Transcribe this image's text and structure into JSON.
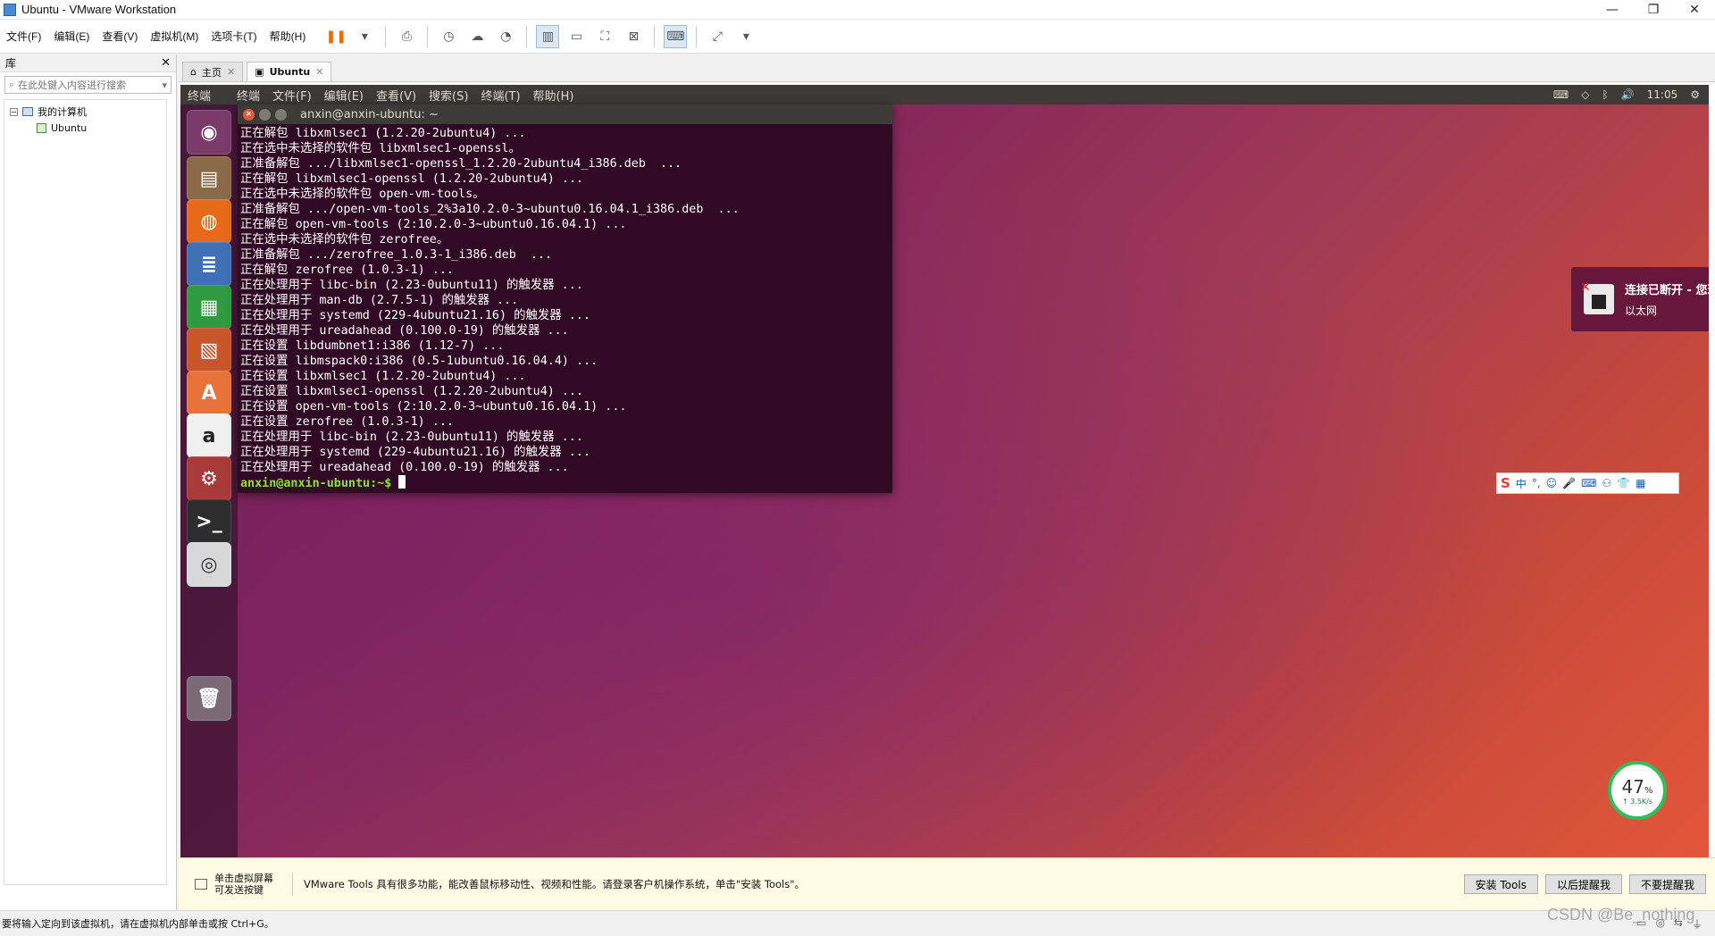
{
  "window": {
    "title": "Ubuntu - VMware Workstation",
    "minimize": "—",
    "restore": "❐",
    "close": "✕"
  },
  "menu": [
    "文件(F)",
    "编辑(E)",
    "查看(V)",
    "虚拟机(M)",
    "选项卡(T)",
    "帮助(H)"
  ],
  "library": {
    "title": "库",
    "search_placeholder": "在此处键入内容进行搜索",
    "root": "我的计算机",
    "vm": "Ubuntu"
  },
  "tabs": [
    {
      "label": "主页"
    },
    {
      "label": "Ubuntu"
    }
  ],
  "ubuntu": {
    "app_name": "终端",
    "menus": [
      "终端",
      "文件(F)",
      "编辑(E)",
      "查看(V)",
      "搜索(S)",
      "终端(T)",
      "帮助(H)"
    ],
    "clock": "11:05"
  },
  "terminal": {
    "title": "anxin@anxin-ubuntu: ~",
    "lines": [
      "正在解包 libxmlsec1 (1.2.20-2ubuntu4) ...",
      "正在选中未选择的软件包 libxmlsec1-openssl。",
      "正准备解包 .../libxmlsec1-openssl_1.2.20-2ubuntu4_i386.deb  ...",
      "正在解包 libxmlsec1-openssl (1.2.20-2ubuntu4) ...",
      "正在选中未选择的软件包 open-vm-tools。",
      "正准备解包 .../open-vm-tools_2%3a10.2.0-3~ubuntu0.16.04.1_i386.deb  ...",
      "正在解包 open-vm-tools (2:10.2.0-3~ubuntu0.16.04.1) ...",
      "正在选中未选择的软件包 zerofree。",
      "正准备解包 .../zerofree_1.0.3-1_i386.deb  ...",
      "正在解包 zerofree (1.0.3-1) ...",
      "正在处理用于 libc-bin (2.23-0ubuntu11) 的触发器 ...",
      "正在处理用于 man-db (2.7.5-1) 的触发器 ...",
      "正在处理用于 systemd (229-4ubuntu21.16) 的触发器 ...",
      "正在处理用于 ureadahead (0.100.0-19) 的触发器 ...",
      "正在设置 libdumbnet1:i386 (1.12-7) ...",
      "正在设置 libmspack0:i386 (0.5-1ubuntu0.16.04.4) ...",
      "正在设置 libxmlsec1 (1.2.20-2ubuntu4) ...",
      "正在设置 libxmlsec1-openssl (1.2.20-2ubuntu4) ...",
      "正在设置 open-vm-tools (2:10.2.0-3~ubuntu0.16.04.1) ...",
      "正在设置 zerofree (1.0.3-1) ...",
      "正在处理用于 libc-bin (2.23-0ubuntu11) 的触发器 ...",
      "正在处理用于 systemd (229-4ubuntu21.16) 的触发器 ...",
      "正在处理用于 ureadahead (0.100.0-19) 的触发器 ..."
    ],
    "prompt": "anxin@anxin-ubuntu:~$ "
  },
  "notification": {
    "title": "连接已断开 - 您现在处于离线状态",
    "body": "以太网"
  },
  "ime": {
    "logo": "S",
    "items": [
      "中",
      "°,",
      "☺",
      "🎤",
      "⌨",
      "⚇",
      "👕",
      "▦"
    ]
  },
  "meter": {
    "percent": "47",
    "unit": "%",
    "speed": "↑ 3.5K/s",
    "level": 0.47
  },
  "toolsbar": {
    "hint": "单击虚拟屏幕\n可发送按键",
    "message": "VMware Tools 具有很多功能，能改善鼠标移动性、视频和性能。请登录客户机操作系统，单击\"安装 Tools\"。",
    "install": "安装 Tools",
    "later": "以后提醒我",
    "never": "不要提醒我"
  },
  "status": {
    "text": "要将输入定向到该虚拟机，请在虚拟机内部单击或按 Ctrl+G。"
  },
  "watermark": "CSDN @Be_nothing",
  "colors": {
    "accent": "#e86b10",
    "terminal_bg": "#300a24",
    "prompt": "#8ae234"
  }
}
